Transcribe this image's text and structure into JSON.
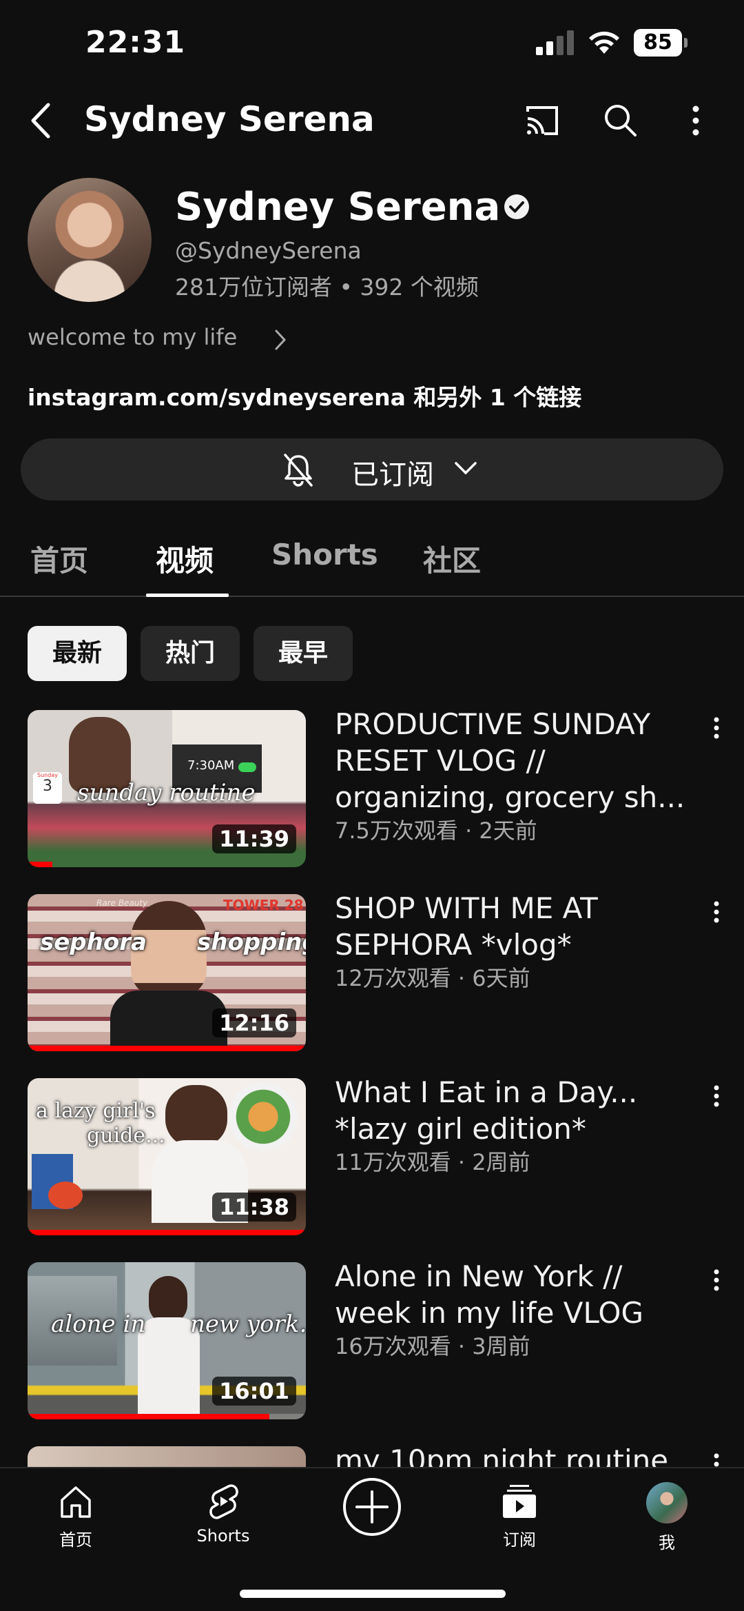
{
  "status": {
    "time": "22:31",
    "battery": "85"
  },
  "header": {
    "title": "Sydney Serena"
  },
  "channel": {
    "name": "Sydney Serena",
    "handle": "@SydneySerena",
    "stats": "281万位订阅者 • 392 个视频",
    "description": "welcome to my life",
    "links": "instagram.com/sydneyserena 和另外 1 个链接",
    "subscribe_label": "已订阅"
  },
  "tabs": [
    "首页",
    "视频",
    "Shorts",
    "社区"
  ],
  "active_tab": "视频",
  "chips": [
    "最新",
    "热门",
    "最早"
  ],
  "selected_chip": "最新",
  "videos": [
    {
      "title": "PRODUCTIVE SUNDAY RESET VLOG // organizing, grocery sh...",
      "meta": "7.5万次观看 · 2天前",
      "duration": "11:39",
      "thumb_text": "sunday routine",
      "thumb_time": "7:30AM",
      "calendar_day": "Sunday",
      "calendar_date": "3",
      "watched": 0.09
    },
    {
      "title": "SHOP WITH ME AT SEPHORA *vlog*",
      "meta": "12万次观看 · 6天前",
      "duration": "12:16",
      "thumb_text_left": "sephora",
      "thumb_text_right": "shopping",
      "thumb_brand": "Rare Beauty",
      "thumb_sign": "TOWER 28",
      "watched": 1.0
    },
    {
      "title": "What I Eat in a Day... *lazy girl edition*",
      "meta": "11万次观看 · 2周前",
      "duration": "11:38",
      "thumb_text_line1": "a lazy girl's",
      "thumb_text_line2": "guide...",
      "watched": 1.0
    },
    {
      "title": "Alone in New York // week in my life VLOG",
      "meta": "16万次观看 · 3周前",
      "duration": "16:01",
      "thumb_text_left": "alone in",
      "thumb_text_right": "new york.",
      "watched": 0.87
    },
    {
      "title": "my 10pm night routine",
      "meta": "",
      "duration": ""
    }
  ],
  "bottom_nav": {
    "home": "首页",
    "shorts": "Shorts",
    "subscriptions": "订阅",
    "me": "我"
  }
}
